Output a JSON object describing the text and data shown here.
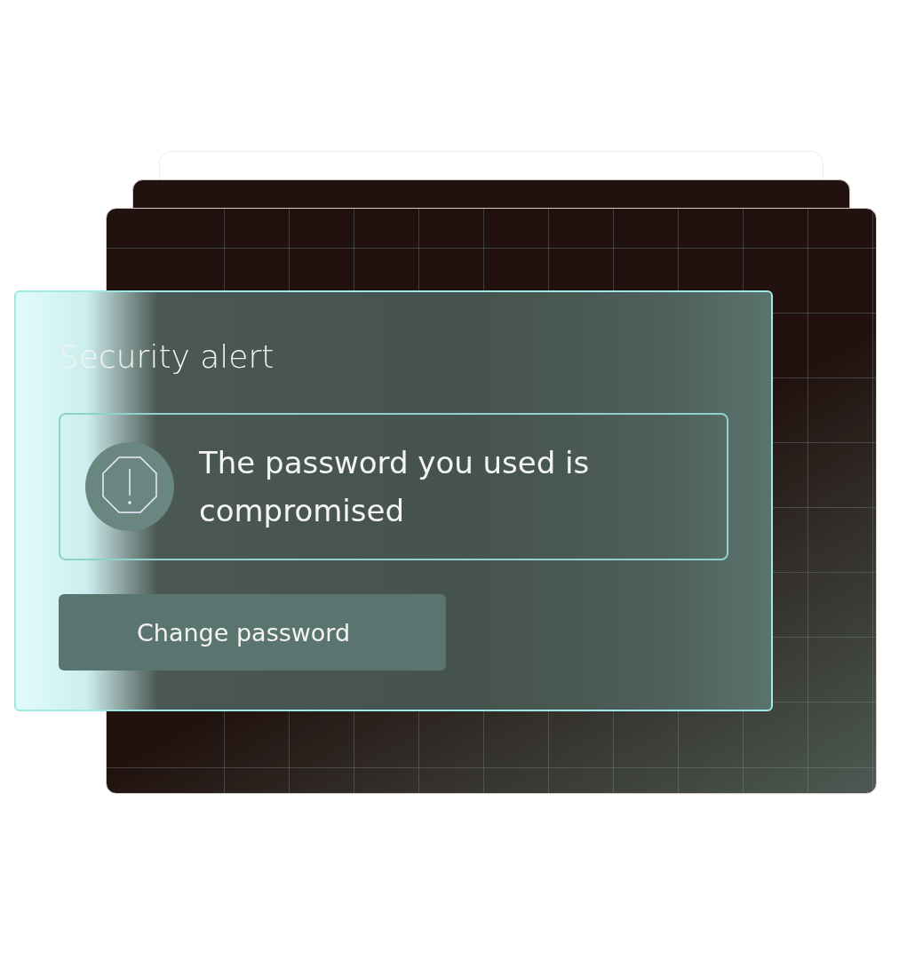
{
  "alert": {
    "title": "Security alert",
    "message": "The password you used is compromised",
    "button": "Change password"
  }
}
